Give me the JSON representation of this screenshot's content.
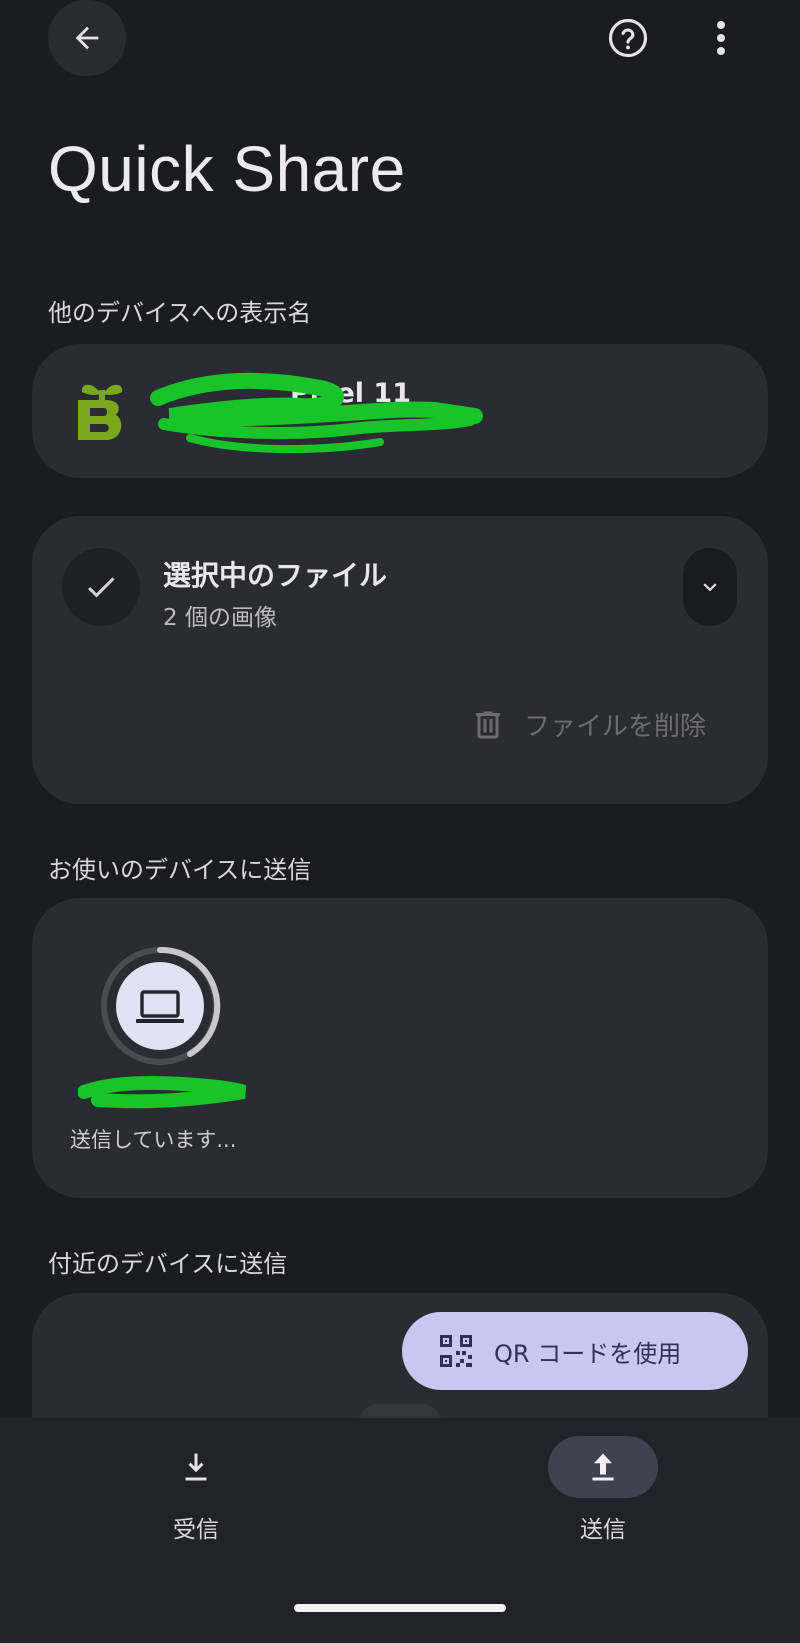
{
  "header": {
    "back_icon": "arrow-left-icon",
    "help_icon": "help-circle-icon",
    "more_icon": "more-vert-icon",
    "title": "Quick Share"
  },
  "device_name_section": {
    "label": "他のデバイスへの表示名",
    "device_name": "Pixel 11",
    "logo_icon": "sprout-b-logo"
  },
  "selected_files": {
    "title": "選択中のファイル",
    "subtitle": "2 個の画像",
    "delete_label": "ファイルを削除",
    "check_icon": "check-icon",
    "expand_icon": "chevron-down-icon",
    "delete_icon": "trash-icon"
  },
  "my_devices": {
    "label": "お使いのデバイスに送信",
    "status": "送信しています...",
    "device_icon": "laptop-icon"
  },
  "nearby": {
    "label": "付近のデバイスに送信",
    "qr_label": "QR コードを使用",
    "qr_icon": "qr-code-icon"
  },
  "bottom_nav": {
    "receive_label": "受信",
    "send_label": "送信",
    "receive_icon": "download-icon",
    "send_icon": "upload-icon",
    "active": "send"
  },
  "colors": {
    "background": "#1b1c21",
    "card": "#2b2c33",
    "accent": "#c6c8f0",
    "logo_green": "#7aa81c",
    "redaction_green": "#19c42a"
  }
}
